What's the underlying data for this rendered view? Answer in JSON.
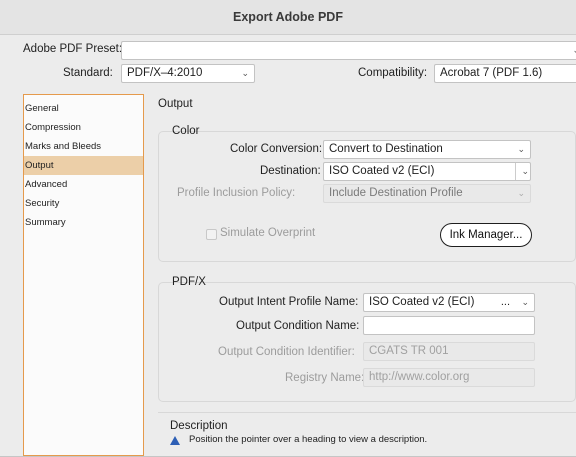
{
  "window": {
    "title": "Export Adobe PDF"
  },
  "top": {
    "preset_label": "Adobe PDF Preset:",
    "preset_value": "",
    "standard_label": "Standard:",
    "standard_value": "PDF/X–4:2010",
    "compat_label": "Compatibility:",
    "compat_value": "Acrobat 7 (PDF 1.6)"
  },
  "sidebar": {
    "items": [
      {
        "label": "General"
      },
      {
        "label": "Compression"
      },
      {
        "label": "Marks and Bleeds"
      },
      {
        "label": "Output",
        "selected": true
      },
      {
        "label": "Advanced"
      },
      {
        "label": "Security"
      },
      {
        "label": "Summary"
      }
    ]
  },
  "main": {
    "heading": "Output",
    "color": {
      "title": "Color",
      "conversion_label": "Color Conversion:",
      "conversion_value": "Convert to Destination",
      "destination_label": "Destination:",
      "destination_value": "ISO Coated v2 (ECI)",
      "profile_label": "Profile Inclusion Policy:",
      "profile_value": "Include Destination Profile",
      "overprint_label": "Simulate Overprint",
      "ink_manager_label": "Ink Manager..."
    },
    "pdfx": {
      "title": "PDF/X",
      "intent_label": "Output Intent Profile Name:",
      "intent_value": "ISO Coated v2 (ECI)",
      "intent_ellipsis": "...",
      "condition_name_label": "Output Condition Name:",
      "condition_name_value": "",
      "condition_id_label": "Output Condition Identifier:",
      "condition_id_value": "CGATS TR 001",
      "registry_label": "Registry Name:",
      "registry_value": "http://www.color.org"
    },
    "description": {
      "title": "Description",
      "text": "Position the pointer over a heading to view a description."
    }
  },
  "icons": {
    "info": "warning-triangle-icon",
    "dropdown": "chevron-down-icon"
  },
  "colors": {
    "accent": "#e59a4c",
    "selected_bg": "#eccfa8",
    "info_blue": "#2d5fb5"
  }
}
